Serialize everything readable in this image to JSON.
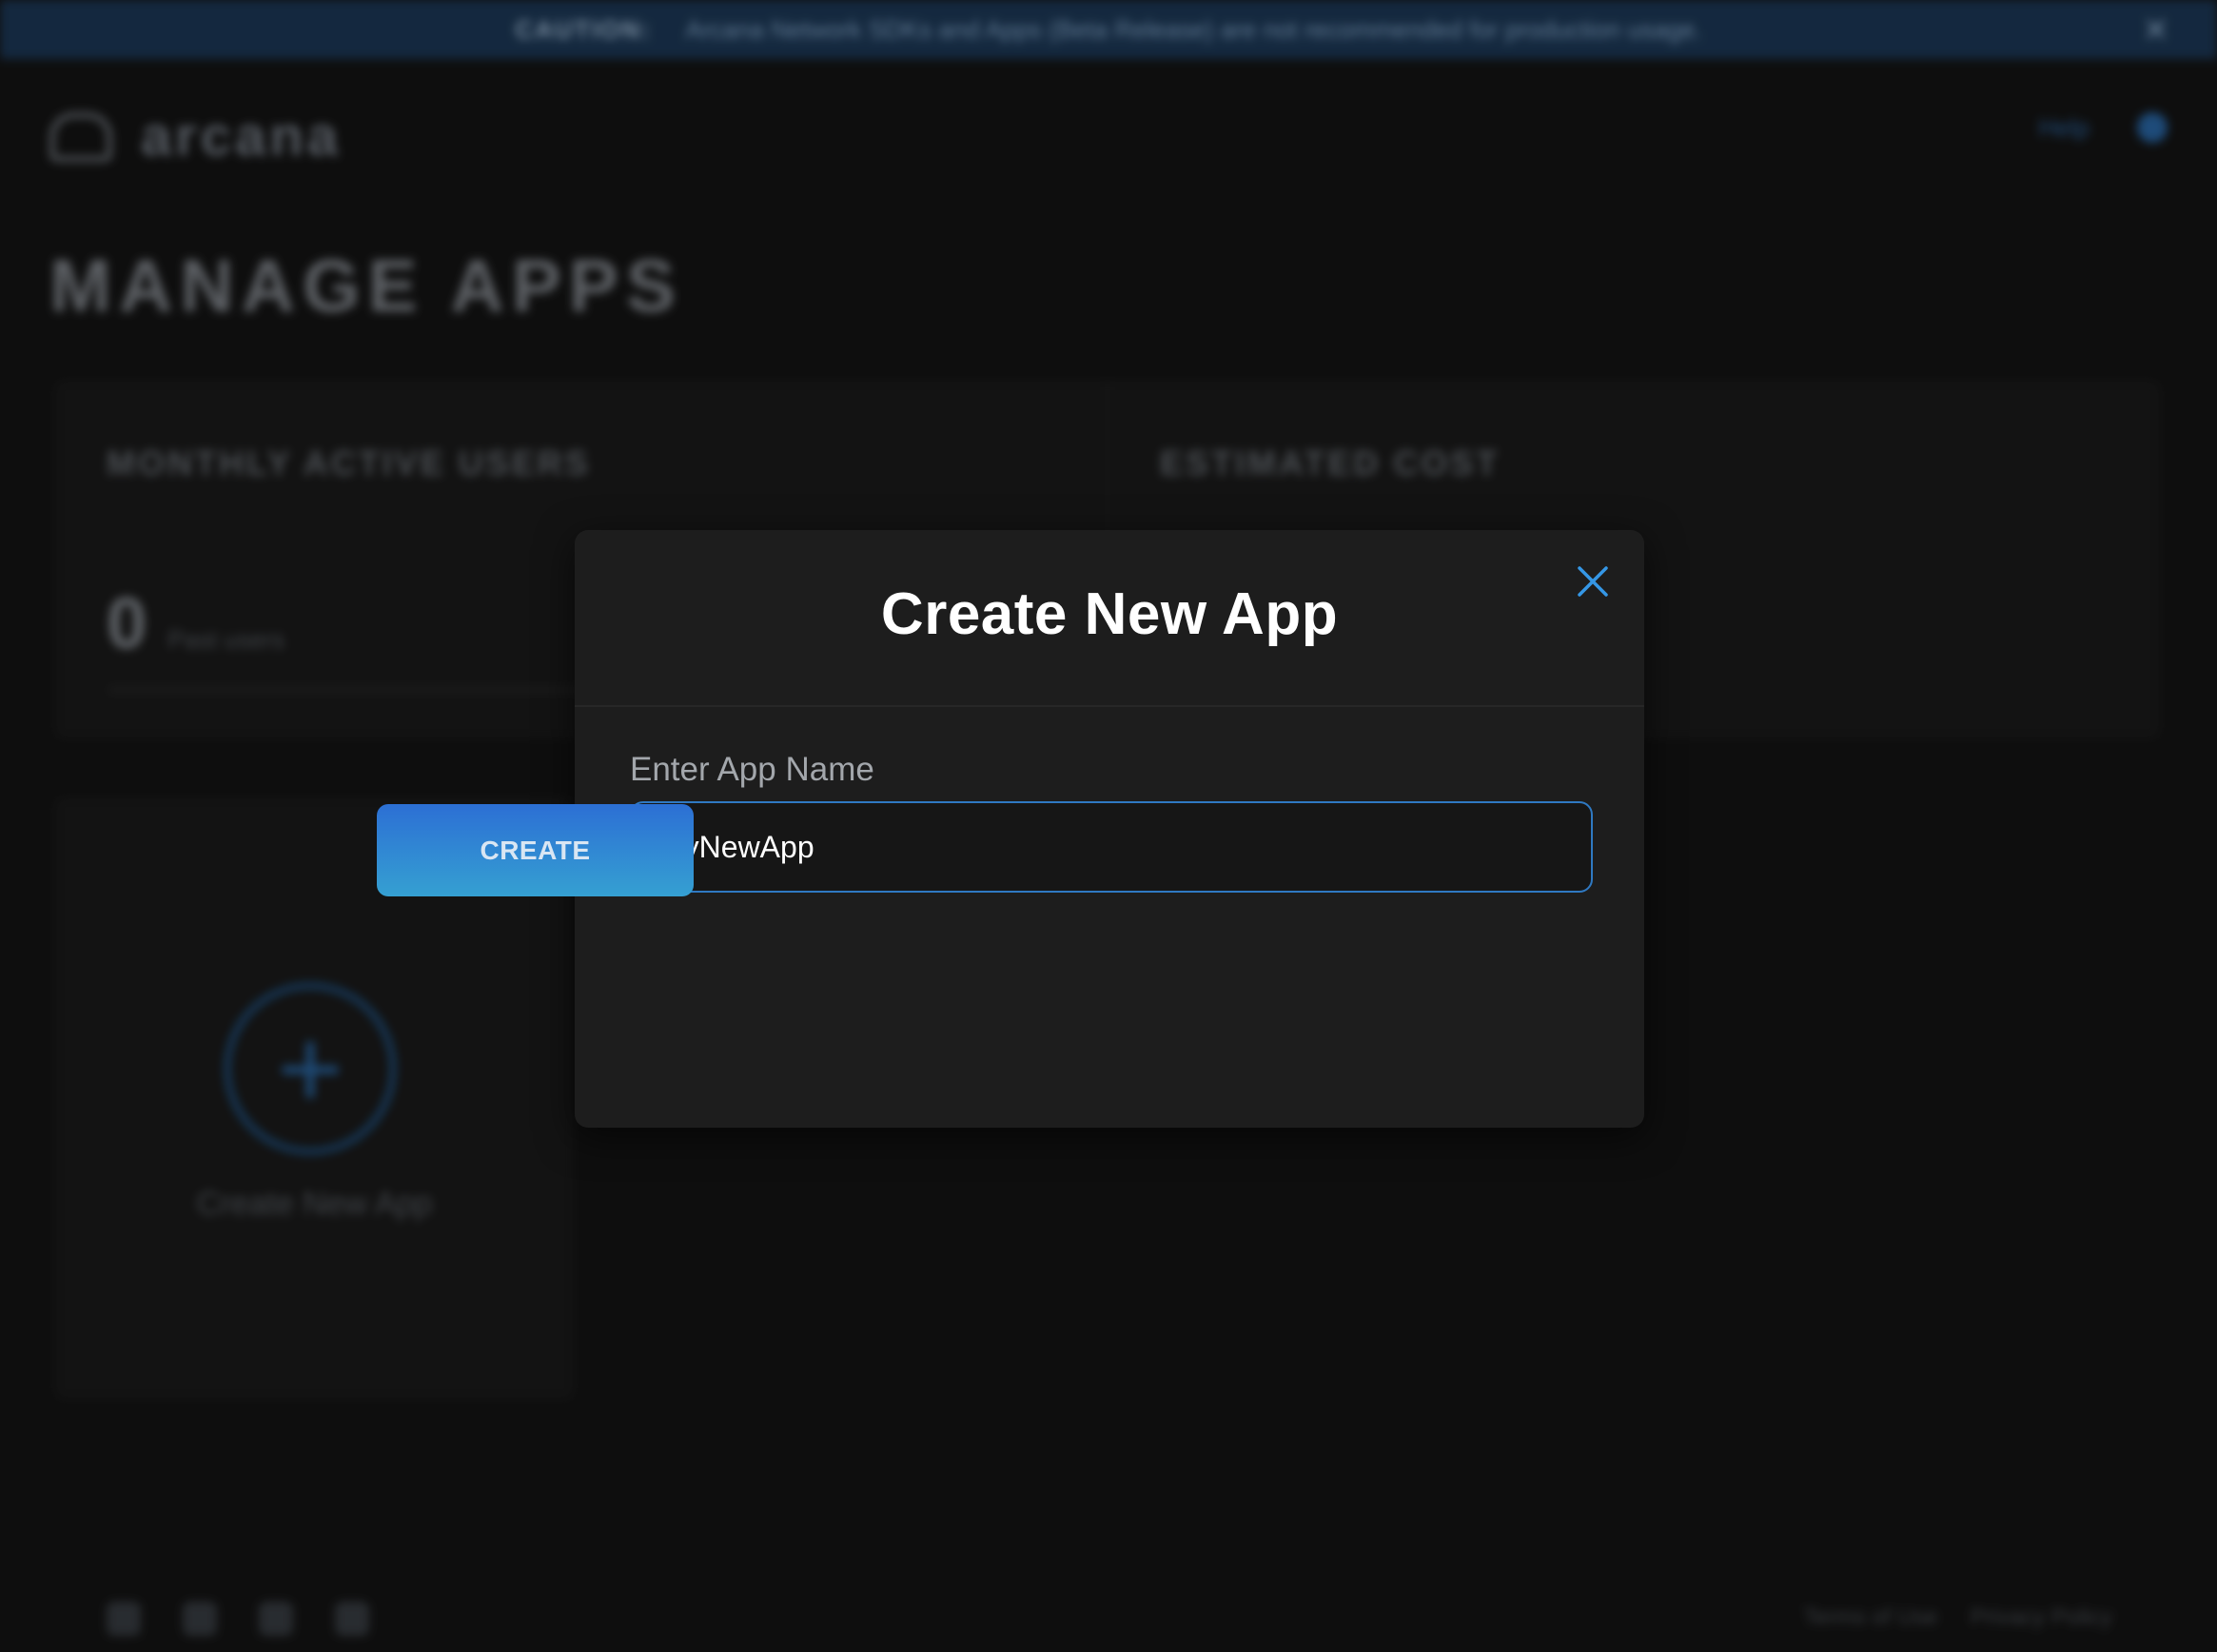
{
  "banner": {
    "title": "CAUTION:",
    "message": "Arcana Network SDKs and Apps (Beta Release) are not recommended for production usage.",
    "close_glyph": "✕"
  },
  "header": {
    "logo_text": "arcana",
    "help_label": "Help"
  },
  "page": {
    "title": "MANAGE APPS"
  },
  "stats": {
    "mau_label": "MONTHLY ACTIVE USERS",
    "mau_value": "0",
    "mau_unit": "Past users",
    "cost_label": "ESTIMATED COST"
  },
  "create_card": {
    "plus_glyph": "+",
    "label": "Create New App"
  },
  "footer": {
    "terms_label": "Terms of Use",
    "privacy_label": "Privacy Policy",
    "icons": [
      "twitter-icon",
      "telegram-icon",
      "discord-icon",
      "chat-icon"
    ]
  },
  "modal": {
    "title": "Create New App",
    "field_label": "Enter App Name",
    "input_value": "MyNewApp",
    "create_label": "CREATE"
  },
  "colors": {
    "accent": "#2f79c2",
    "button_top": "#2c6fd4",
    "button_bottom": "#35a0d2",
    "modal_bg": "#1d1d1d",
    "page_bg": "#121212"
  }
}
